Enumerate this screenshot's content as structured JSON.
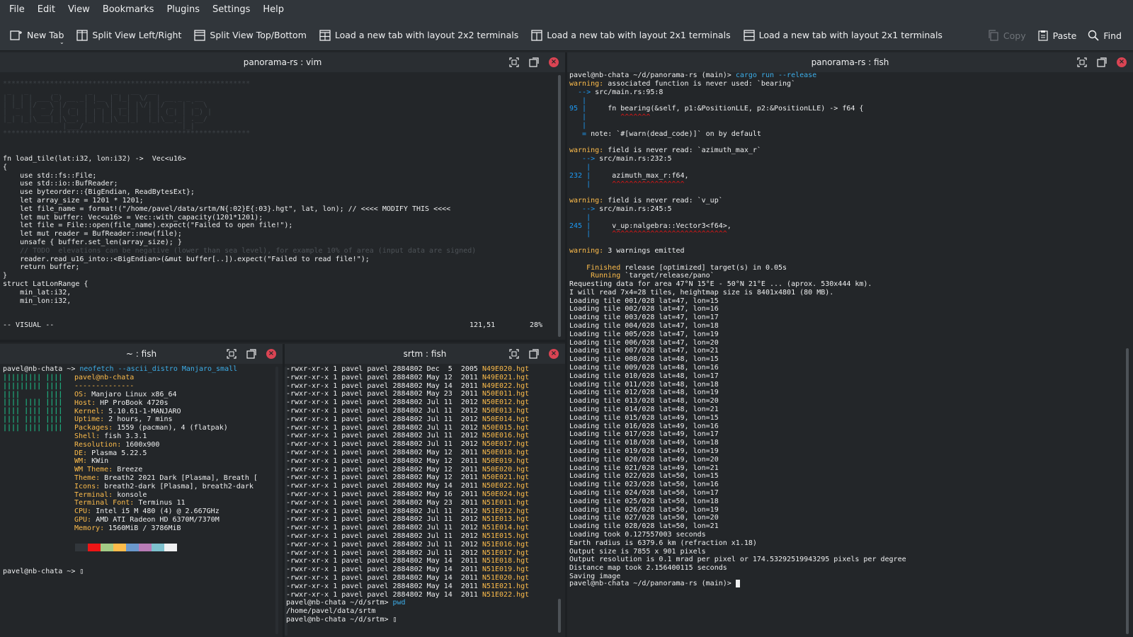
{
  "menubar": {
    "items": [
      "File",
      "Edit",
      "View",
      "Bookmarks",
      "Plugins",
      "Settings",
      "Help"
    ]
  },
  "toolbar": {
    "new_tab": "New Tab",
    "split_lr": "Split View Left/Right",
    "split_tb": "Split View Top/Bottom",
    "layout_2x2": "Load a new tab with layout 2x2 terminals",
    "layout_2x1_a": "Load a new tab with layout 2x1 terminals",
    "layout_2x1_b": "Load a new tab with layout 2x1 terminals",
    "copy": "Copy",
    "paste": "Paste",
    "find": "Find"
  },
  "panes": {
    "vim": {
      "title": "panorama-rs : vim",
      "status_mode": "-- VISUAL --",
      "status_pos": "121,51",
      "status_pct": "28%"
    },
    "fish_right": {
      "title": "panorama-rs : fish"
    },
    "fish_home": {
      "title": "~ : fish"
    },
    "srtm": {
      "title": "srtm : fish"
    }
  },
  "vim_code": [
    "fn load_tile(lat:i32, lon:i32) ->  Vec<u16>",
    "{",
    "    use std::fs::File;",
    "    use std::io::BufReader;",
    "    use byteorder::{BigEndian, ReadBytesExt};",
    "    let array_size = 1201 * 1201;",
    "    let file_name = format!(\"/home/pavel/data/srtm/N{:02}E{:03}.hgt\", lat, lon); // <<<< MODIFY THIS <<<<",
    "    let mut buffer: Vec<u16> = Vec::with_capacity(1201*1201);",
    "    let file = File::open(file_name).expect(\"Failed to open file!\");",
    "    let mut reader = BufReader::new(file);",
    "    unsafe { buffer.set_len(array_size); }",
    "    // TODO  elevations can be negative (lower than sea level), for example 10% of area (input data are signed)",
    "    reader.read_u16_into::<BigEndian>(&mut buffer[..]).expect(\"Failed to read file!\");",
    "    return buffer;",
    "}",
    "",
    "",
    "struct LatLonRange {",
    "    min_lat:i32,",
    "    min_lon:i32,"
  ],
  "neofetch": {
    "prompt": "pavel@nb-chata ~> ",
    "command": "neofetch --ascii_distro Manjaro_small",
    "user_host": "pavel@nb-chata",
    "separator": "--------------",
    "info": [
      "OS: Manjaro Linux x86_64",
      "Host: HP ProBook 4720s",
      "Kernel: 5.10.61-1-MANJARO",
      "Uptime: 2 hours, 7 mins",
      "Packages: 1559 (pacman), 4 (flatpak)",
      "Shell: fish 3.3.1",
      "Resolution: 1600x900",
      "DE: Plasma 5.22.5",
      "WM: KWin",
      "WM Theme: Breeze",
      "Theme: Breath2 2021 Dark [Plasma], Breath [",
      "Icons: breath2-dark [Plasma], breath2-dark",
      "Terminal: konsole",
      "Terminal Font: Terminus 11",
      "CPU: Intel i5 M 480 (4) @ 2.667GHz",
      "GPU: AMD ATI Radeon HD 6370M/7370M",
      "Memory: 1560MiB / 3786MiB"
    ],
    "logo": [
      "||||||||| ||||",
      "||||||||| ||||",
      "||||      ||||",
      "|||| |||| ||||",
      "|||| |||| ||||",
      "|||| |||| ||||",
      "|||| |||| ||||"
    ],
    "swatches": [
      "#31363b",
      "#ed1515",
      "#a4cc86",
      "#fdbc4b",
      "#6a98cc",
      "#b87cb6",
      "#7ec1ce",
      "#eff0f1"
    ],
    "final_prompt": "pavel@nb-chata ~> "
  },
  "srtm_listing": [
    [
      "-rwxr-xr-x 1 pavel pavel 2884802 Dec  5  2005",
      "N49E020.hgt"
    ],
    [
      "-rwxr-xr-x 1 pavel pavel 2884802 May 12  2011",
      "N49E021.hgt"
    ],
    [
      "-rwxr-xr-x 1 pavel pavel 2884802 May 14  2011",
      "N49E022.hgt"
    ],
    [
      "-rwxr-xr-x 1 pavel pavel 2884802 May 23  2011",
      "N50E011.hgt"
    ],
    [
      "-rwxr-xr-x 1 pavel pavel 2884802 Jul 11  2012",
      "N50E012.hgt"
    ],
    [
      "-rwxr-xr-x 1 pavel pavel 2884802 Jul 11  2012",
      "N50E013.hgt"
    ],
    [
      "-rwxr-xr-x 1 pavel pavel 2884802 Jul 11  2012",
      "N50E014.hgt"
    ],
    [
      "-rwxr-xr-x 1 pavel pavel 2884802 Jul 11  2012",
      "N50E015.hgt"
    ],
    [
      "-rwxr-xr-x 1 pavel pavel 2884802 Jul 11  2012",
      "N50E016.hgt"
    ],
    [
      "-rwxr-xr-x 1 pavel pavel 2884802 Jul 11  2012",
      "N50E017.hgt"
    ],
    [
      "-rwxr-xr-x 1 pavel pavel 2884802 May 12  2011",
      "N50E018.hgt"
    ],
    [
      "-rwxr-xr-x 1 pavel pavel 2884802 May 12  2011",
      "N50E019.hgt"
    ],
    [
      "-rwxr-xr-x 1 pavel pavel 2884802 May 12  2011",
      "N50E020.hgt"
    ],
    [
      "-rwxr-xr-x 1 pavel pavel 2884802 May 12  2011",
      "N50E021.hgt"
    ],
    [
      "-rwxr-xr-x 1 pavel pavel 2884802 May 14  2011",
      "N50E022.hgt"
    ],
    [
      "-rwxr-xr-x 1 pavel pavel 2884802 May 16  2011",
      "N50E024.hgt"
    ],
    [
      "-rwxr-xr-x 1 pavel pavel 2884802 May 23  2011",
      "N51E011.hgt"
    ],
    [
      "-rwxr-xr-x 1 pavel pavel 2884802 Jul 11  2012",
      "N51E012.hgt"
    ],
    [
      "-rwxr-xr-x 1 pavel pavel 2884802 Jul 11  2012",
      "N51E013.hgt"
    ],
    [
      "-rwxr-xr-x 1 pavel pavel 2884802 Jul 11  2012",
      "N51E014.hgt"
    ],
    [
      "-rwxr-xr-x 1 pavel pavel 2884802 Jul 11  2012",
      "N51E015.hgt"
    ],
    [
      "-rwxr-xr-x 1 pavel pavel 2884802 Jul 11  2012",
      "N51E016.hgt"
    ],
    [
      "-rwxr-xr-x 1 pavel pavel 2884802 Jul 11  2012",
      "N51E017.hgt"
    ],
    [
      "-rwxr-xr-x 1 pavel pavel 2884802 May 14  2011",
      "N51E018.hgt"
    ],
    [
      "-rwxr-xr-x 1 pavel pavel 2884802 May 14  2011",
      "N51E019.hgt"
    ],
    [
      "-rwxr-xr-x 1 pavel pavel 2884802 May 14  2011",
      "N51E020.hgt"
    ],
    [
      "-rwxr-xr-x 1 pavel pavel 2884802 May 14  2011",
      "N51E021.hgt"
    ],
    [
      "-rwxr-xr-x 1 pavel pavel 2884802 May 14  2011",
      "N51E022.hgt"
    ]
  ],
  "srtm_tail": {
    "prompt1": "pavel@nb-chata ~/d/srtm> ",
    "cmd1": "pwd",
    "output": "/home/pavel/data/srtm",
    "prompt2": "pavel@nb-chata ~/d/srtm> "
  },
  "cargo": {
    "prompt": "pavel@nb-chata ~/d/panorama-rs (main)> ",
    "command": "cargo run --release",
    "lines_pre": [
      [
        "warn",
        "warning: ",
        "associated function is never used: `bearing`"
      ],
      [
        "blue",
        "  --> ",
        "src/main.rs:95:8"
      ],
      [
        "blue",
        "   |",
        ""
      ],
      [
        "blue",
        "95 |",
        "     fn bearing(&self, p1:&PositionLLE, p2:&PositionLLE) -> f64 {"
      ],
      [
        "red",
        "   |",
        "        ^^^^^^^"
      ],
      [
        "blue",
        "   |",
        ""
      ],
      [
        "blue",
        "   = ",
        "note: `#[warn(dead_code)]` on by default"
      ],
      [
        "plain",
        "",
        ""
      ],
      [
        "warn",
        "warning: ",
        "field is never read: `azimuth_max_r`"
      ],
      [
        "blue",
        "   --> ",
        "src/main.rs:232:5"
      ],
      [
        "blue",
        "    |",
        ""
      ],
      [
        "blue",
        "232 |",
        "     azimuth_max_r:f64,"
      ],
      [
        "red",
        "    |",
        "     ^^^^^^^^^^^^^^^^^"
      ],
      [
        "plain",
        "",
        ""
      ],
      [
        "warn",
        "warning: ",
        "field is never read: `v_up`"
      ],
      [
        "blue",
        "   --> ",
        "src/main.rs:245:5"
      ],
      [
        "blue",
        "    |",
        ""
      ],
      [
        "blue",
        "245 |",
        "     v_up:nalgebra::Vector3<f64>,"
      ],
      [
        "red",
        "    |",
        "     ^^^^^^^^^^^^^^^^^^^^^^^^^^^"
      ],
      [
        "plain",
        "",
        ""
      ],
      [
        "warn",
        "warning: ",
        "3 warnings emitted"
      ],
      [
        "plain",
        "",
        ""
      ],
      [
        "green",
        "    Finished ",
        "release [optimized] target(s) in 0.05s"
      ],
      [
        "green",
        "     Running ",
        "`target/release/pano`"
      ]
    ],
    "output": [
      "Requesting data for area 47°N 15°E - 50°N 21°E ... (aprox. 530x444 km).",
      "I will read 7x4=28 tiles, heightmap size is 8401x4801 (80 MB).",
      "Loading tile 001/028 lat=47, lon=15",
      "Loading tile 002/028 lat=47, lon=16",
      "Loading tile 003/028 lat=47, lon=17",
      "Loading tile 004/028 lat=47, lon=18",
      "Loading tile 005/028 lat=47, lon=19",
      "Loading tile 006/028 lat=47, lon=20",
      "Loading tile 007/028 lat=47, lon=21",
      "Loading tile 008/028 lat=48, lon=15",
      "Loading tile 009/028 lat=48, lon=16",
      "Loading tile 010/028 lat=48, lon=17",
      "Loading tile 011/028 lat=48, lon=18",
      "Loading tile 012/028 lat=48, lon=19",
      "Loading tile 013/028 lat=48, lon=20",
      "Loading tile 014/028 lat=48, lon=21",
      "Loading tile 015/028 lat=49, lon=15",
      "Loading tile 016/028 lat=49, lon=16",
      "Loading tile 017/028 lat=49, lon=17",
      "Loading tile 018/028 lat=49, lon=18",
      "Loading tile 019/028 lat=49, lon=19",
      "Loading tile 020/028 lat=49, lon=20",
      "Loading tile 021/028 lat=49, lon=21",
      "Loading tile 022/028 lat=50, lon=15",
      "Loading tile 023/028 lat=50, lon=16",
      "Loading tile 024/028 lat=50, lon=17",
      "Loading tile 025/028 lat=50, lon=18",
      "Loading tile 026/028 lat=50, lon=19",
      "Loading tile 027/028 lat=50, lon=20",
      "Loading tile 028/028 lat=50, lon=21",
      "Loading took 0.127557003 seconds",
      "Earth radius is 6379.6 km (refraction x1.18)",
      "Output size is 7855 x 901 pixels",
      "Output resolution is 0.1 mrad per pixel or 174.53292519943295 pixels per degree",
      "Distance map took 2.156400115 seconds",
      "Saving image"
    ],
    "final_prompt": "pavel@nb-chata ~/d/panorama-rs (main)> "
  }
}
